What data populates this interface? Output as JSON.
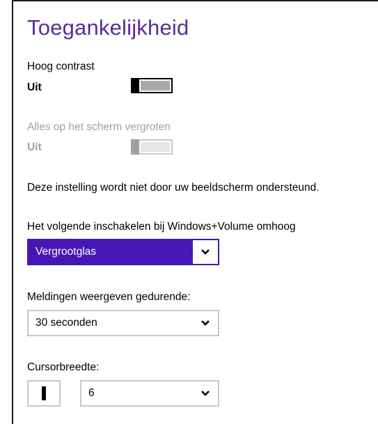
{
  "header": {
    "title": "Toegankelijkheid"
  },
  "high_contrast": {
    "label": "Hoog contrast",
    "state": "Uit"
  },
  "magnify": {
    "label": "Alles op het scherm vergroten",
    "state": "Uit"
  },
  "notice": "Deze instelling wordt niet door uw beeldscherm ondersteund.",
  "hotkey": {
    "label": "Het volgende inschakelen bij Windows+Volume omhoog",
    "selected": "Vergrootglas"
  },
  "notifications": {
    "label": "Meldingen weergeven gedurende:",
    "selected": "30 seconden"
  },
  "cursor": {
    "label": "Cursorbreedte:",
    "selected": "6"
  },
  "colors": {
    "title": "#5b2d9c",
    "text": "#000000",
    "disabled": "#a0a0a0",
    "accent": "#4617b4",
    "control_border": "#c8c8c8",
    "toggle_on_fill": "#a9a9a9",
    "toggle_disabled_fill": "#e6e6e6"
  },
  "icons": {
    "dropdown": "chevron-down-icon"
  }
}
